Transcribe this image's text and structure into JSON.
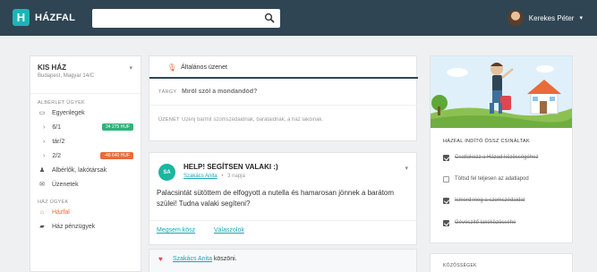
{
  "topbar": {
    "brand_letter": "H",
    "brand_name": "HÁZFAL",
    "search_value": "",
    "user_name": "Kerekes Péter"
  },
  "sidebar": {
    "household": {
      "title": "KIS HÁZ",
      "address": "Budapest, Magyar 14/C"
    },
    "section_apartment": "ALBÉRLET ÜGYEK",
    "items_apartment": [
      {
        "label": "Egyenlegek",
        "icon": "balance-icon"
      },
      {
        "label": "6/1",
        "badge": "34 275 HUF",
        "badge_color": "#2fb37a"
      },
      {
        "label": "tár/2"
      },
      {
        "label": "2/2",
        "badge": "-48 640 HUF",
        "badge_color": "#e86c3a"
      },
      {
        "label": "Albérlők, lakótársak",
        "icon": "person-icon"
      },
      {
        "label": "Üzenetek",
        "icon": "mail-icon"
      }
    ],
    "section_house": "HÁZ ÜGYEK",
    "items_house": [
      {
        "label": "Házfal",
        "icon": "home-icon",
        "active": true
      },
      {
        "label": "Ház pénzügyek",
        "icon": "money-icon"
      }
    ]
  },
  "composer": {
    "tab_label": "Általános üzenet",
    "subject_label": "TÁRGY",
    "subject_placeholder": "Miről szól a mondandód?",
    "message_label": "ÜZENET",
    "message_placeholder": "Üzenj bármit szomszédaidnak, barátaidnak, a ház lakóinak."
  },
  "post": {
    "avatar_initials": "SA",
    "title": "HELP! SEGÍTSEN VALAKI :)",
    "author": "Szakács Anita",
    "time": "3 napja",
    "body": "Palacsintát sütöttem de elfogyott a nutella és hamarosan jönnek a barátom szülei! Tudna valaki segíteni?",
    "action_like": "Megsem kösz",
    "action_reply": "Válaszolok"
  },
  "likes": {
    "name": "Szakács Anita",
    "text": " köszöni."
  },
  "todo": {
    "title": "HÁZFAL INDÍTÓ ÖSSZ CSINÁLTAK",
    "items": [
      {
        "label": "Csatlakozz a Házad közösségéhez",
        "done": true
      },
      {
        "label": "Töltsd fel teljesen az adatlapod",
        "done": false
      },
      {
        "label": "Ismerd meg a szomszédaidat",
        "done": true
      },
      {
        "label": "Gévészítő lakóközösséhe",
        "done": true
      }
    ]
  },
  "next_card": {
    "title": "KÖZÖSSÉGEK"
  },
  "colors": {
    "topbar": "#2f4553",
    "accent_teal": "#1bb5b5",
    "accent_orange": "#e86c3a",
    "link": "#18a5b5"
  }
}
